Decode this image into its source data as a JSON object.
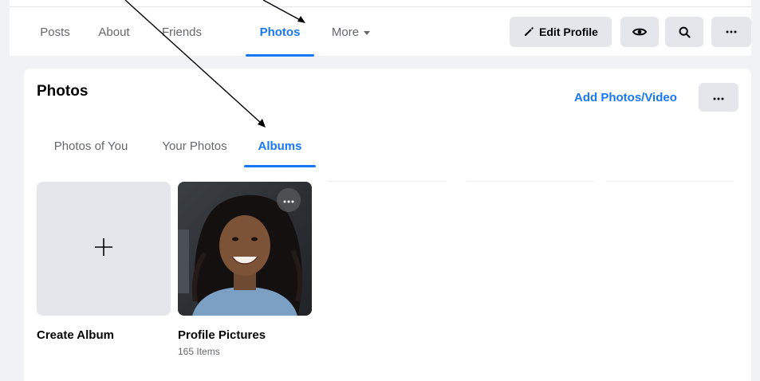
{
  "profile_nav": {
    "tabs": [
      {
        "label": "Posts"
      },
      {
        "label": "About"
      },
      {
        "label": "Friends"
      },
      {
        "label": "Photos",
        "active": true
      },
      {
        "label": "More",
        "dropdown": true
      }
    ],
    "edit_profile_label": "Edit Profile",
    "buttons": [
      "pencil-icon",
      "eye-icon",
      "search-icon",
      "more-horizontal-icon"
    ]
  },
  "photos_section": {
    "title": "Photos",
    "add_link": "Add Photos/Video",
    "more_icon": "more-horizontal-icon",
    "tabs": [
      {
        "label": "Photos of You"
      },
      {
        "label": "Your Photos"
      },
      {
        "label": "Albums",
        "active": true
      }
    ]
  },
  "albums": [
    {
      "label": "Create Album",
      "icon": "plus-icon"
    },
    {
      "label": "Profile Pictures",
      "count": "165 Items",
      "icon": "more-horizontal-icon"
    }
  ],
  "colors": {
    "accent": "#1877f2",
    "muted_text": "#65676b",
    "button_bg": "#e4e6eb",
    "page_bg": "#f0f2f5"
  }
}
